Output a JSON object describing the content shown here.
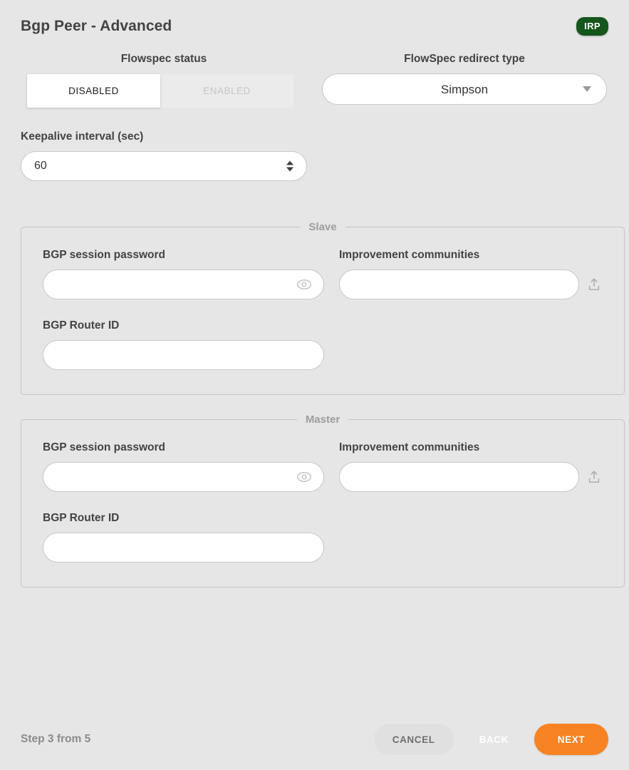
{
  "header": {
    "title": "Bgp Peer - Advanced",
    "badge": "IRP",
    "badge_color": "#14561b"
  },
  "flowspec": {
    "status_label": "Flowspec status",
    "options": [
      {
        "label": "DISABLED",
        "selected": true
      },
      {
        "label": "ENABLED",
        "selected": false
      }
    ],
    "redirect_type_label": "FlowSpec redirect type",
    "redirect_type_value": "Simpson"
  },
  "keepalive": {
    "label": "Keepalive interval (sec)",
    "value": "60"
  },
  "groups": [
    {
      "legend": "Slave",
      "password_label": "BGP session password",
      "password_value": "",
      "communities_label": "Improvement communities",
      "communities_value": "",
      "router_id_label": "BGP Router ID",
      "router_id_value": ""
    },
    {
      "legend": "Master",
      "password_label": "BGP session password",
      "password_value": "",
      "communities_label": "Improvement communities",
      "communities_value": "",
      "router_id_label": "BGP Router ID",
      "router_id_value": ""
    }
  ],
  "footer": {
    "step_text": "Step 3 from 5",
    "cancel_label": "CANCEL",
    "back_label": "BACK",
    "next_label": "NEXT",
    "next_color": "#f78322"
  },
  "icons": {
    "eye": "eye-icon",
    "upload": "upload-icon",
    "chevron_down": "chevron-down-icon",
    "spinner": "number-spinner-icon"
  }
}
